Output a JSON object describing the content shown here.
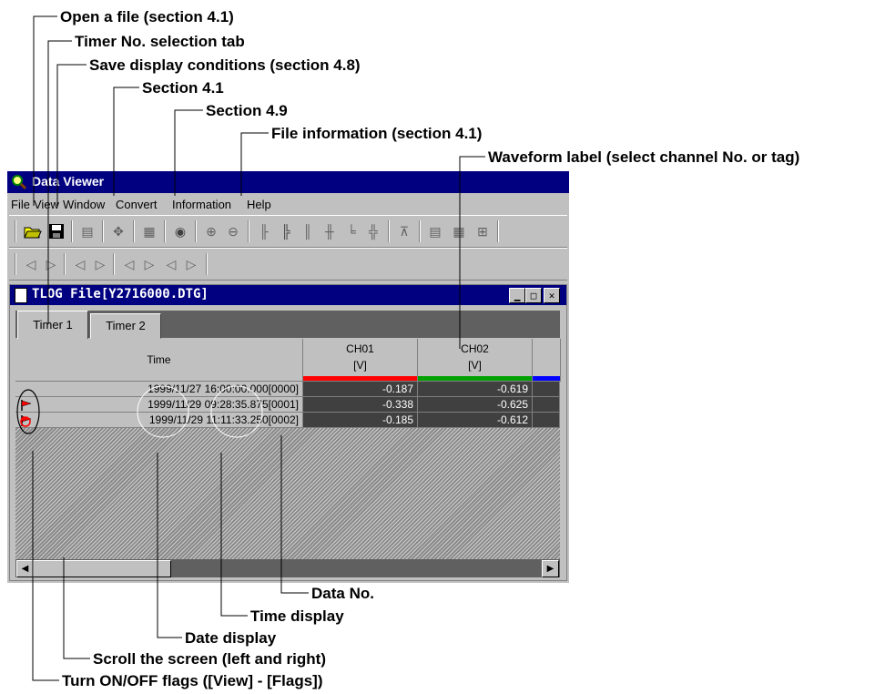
{
  "callouts": {
    "open_file": "Open a file (section 4.1)",
    "timer_tab": "Timer No. selection tab",
    "save_display": "Save display conditions (section 4.8)",
    "section_41": "Section 4.1",
    "section_49": "Section 4.9",
    "file_info": "File information (section 4.1)",
    "waveform_label": "Waveform label (select channel No. or tag)",
    "data_no": "Data No.",
    "time_display": "Time display",
    "date_display": "Date display",
    "scroll": "Scroll the screen (left and right)",
    "flags": "Turn ON/OFF flags ([View] - [Flags])"
  },
  "app": {
    "title": "Data Viewer",
    "menus": [
      "File",
      "View",
      "Window",
      "Convert",
      "Information",
      "Help"
    ]
  },
  "child": {
    "title": "TLOG File[Y2716000.DTG]",
    "tabs": [
      "Timer 1",
      "Timer 2"
    ],
    "window_buttons": [
      "minimize",
      "maximize",
      "close"
    ]
  },
  "grid": {
    "time_header": "Time",
    "columns": [
      {
        "name": "CH01",
        "unit": "[V]",
        "color": "#ff0000"
      },
      {
        "name": "CH02",
        "unit": "[V]",
        "color": "#00a000"
      }
    ],
    "third_column_color": "#0000ff",
    "rows": [
      {
        "time": "1999/11/27 16:00:00.000[0000]",
        "values": [
          "-0.187",
          "-0.619"
        ]
      },
      {
        "time": "1999/11/29 09:28:35.875[0001]",
        "values": [
          "-0.338",
          "-0.625"
        ]
      },
      {
        "time": "1999/11/29 11:11:33.250[0002]",
        "values": [
          "-0.185",
          "-0.612"
        ]
      }
    ]
  },
  "icons": {
    "app": "magnifier-icon",
    "open": "open-folder-icon",
    "save": "floppy-disk-icon",
    "file": "document-icon",
    "flag": "flag-icon"
  },
  "colors": {
    "titlebar": "#000080",
    "window": "#c0c0c0",
    "value_cell": "#404040"
  }
}
